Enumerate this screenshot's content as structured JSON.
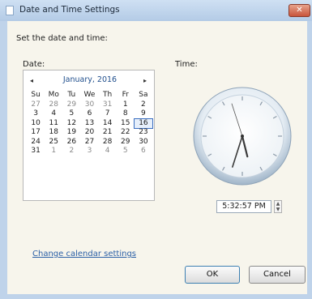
{
  "window": {
    "title": "Date and Time Settings",
    "close_glyph": "✕"
  },
  "heading": "Set the date and time:",
  "date_label": "Date:",
  "time_label": "Time:",
  "calendar": {
    "month_title": "January, 2016",
    "prev_glyph": "◂",
    "next_glyph": "▸",
    "days_of_week": [
      "Su",
      "Mo",
      "Tu",
      "We",
      "Th",
      "Fr",
      "Sa"
    ],
    "cells": [
      {
        "d": "27",
        "other": true
      },
      {
        "d": "28",
        "other": true
      },
      {
        "d": "29",
        "other": true
      },
      {
        "d": "30",
        "other": true
      },
      {
        "d": "31",
        "other": true
      },
      {
        "d": "1"
      },
      {
        "d": "2"
      },
      {
        "d": "3"
      },
      {
        "d": "4"
      },
      {
        "d": "5"
      },
      {
        "d": "6"
      },
      {
        "d": "7"
      },
      {
        "d": "8"
      },
      {
        "d": "9"
      },
      {
        "d": "10"
      },
      {
        "d": "11"
      },
      {
        "d": "12"
      },
      {
        "d": "13"
      },
      {
        "d": "14"
      },
      {
        "d": "15"
      },
      {
        "d": "16",
        "selected": true
      },
      {
        "d": "17"
      },
      {
        "d": "18"
      },
      {
        "d": "19"
      },
      {
        "d": "20"
      },
      {
        "d": "21"
      },
      {
        "d": "22"
      },
      {
        "d": "23"
      },
      {
        "d": "24"
      },
      {
        "d": "25"
      },
      {
        "d": "26"
      },
      {
        "d": "27"
      },
      {
        "d": "28"
      },
      {
        "d": "29"
      },
      {
        "d": "30"
      },
      {
        "d": "31"
      },
      {
        "d": "1",
        "other": true
      },
      {
        "d": "2",
        "other": true
      },
      {
        "d": "3",
        "other": true
      },
      {
        "d": "4",
        "other": true
      },
      {
        "d": "5",
        "other": true
      },
      {
        "d": "6",
        "other": true
      }
    ]
  },
  "clock": {
    "hour": 5,
    "minute": 32,
    "second": 57
  },
  "time_value": "5:32:57 PM",
  "change_calendar_link": "Change calendar settings",
  "buttons": {
    "ok": "OK",
    "cancel": "Cancel"
  },
  "colors": {
    "accent": "#3a6ec0",
    "link": "#2a5fa6",
    "background": "#f0e9cf"
  }
}
